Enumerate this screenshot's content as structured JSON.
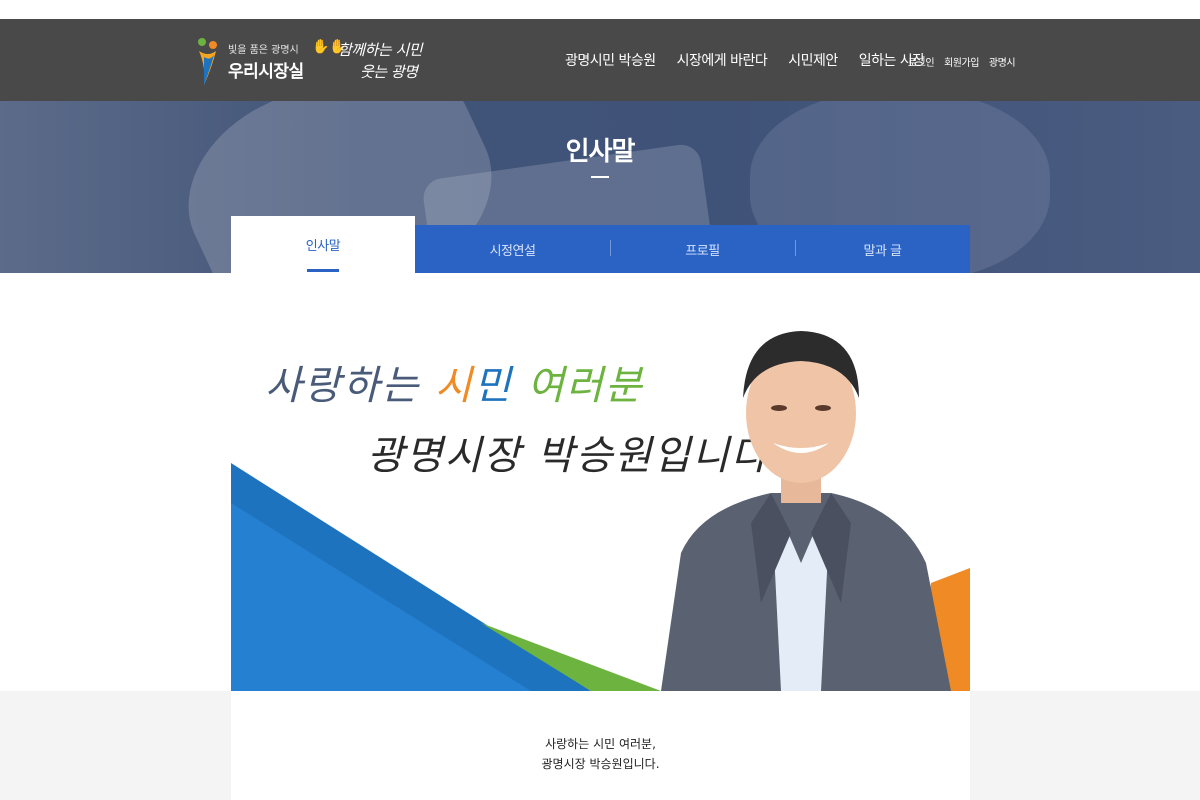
{
  "logo": {
    "sub": "빛을 품은 광명시",
    "main": "우리시장실"
  },
  "slogan": {
    "line1": "함께하는 시민",
    "line2": "웃는 광명"
  },
  "nav": [
    {
      "label": "광명시민 박승원"
    },
    {
      "label": "시장에게 바란다"
    },
    {
      "label": "시민제안"
    },
    {
      "label": "일하는 시장"
    }
  ],
  "util": [
    {
      "label": "로그인"
    },
    {
      "label": "회원가입"
    },
    {
      "label": "광명시"
    }
  ],
  "hero": {
    "title": "인사말"
  },
  "tabs": [
    {
      "label": "인사말",
      "active": true
    },
    {
      "label": "시정연설"
    },
    {
      "label": "프로필"
    },
    {
      "label": "말과 글"
    }
  ],
  "visual": {
    "line1_a": "사랑하는 ",
    "line1_b": "시",
    "line1_c": "민",
    "line1_d": " 여러분",
    "line2": "광명시장 박승원입니다"
  },
  "greeting": {
    "line1": "사랑하는 시민 여러분,",
    "line2": "광명시장 박승원입니다."
  },
  "colors": {
    "header_bg": "#494949",
    "tab_blue": "#2a63c4",
    "accent_orange": "#f08a24",
    "accent_green": "#6db33f",
    "accent_blue": "#1e73be"
  }
}
